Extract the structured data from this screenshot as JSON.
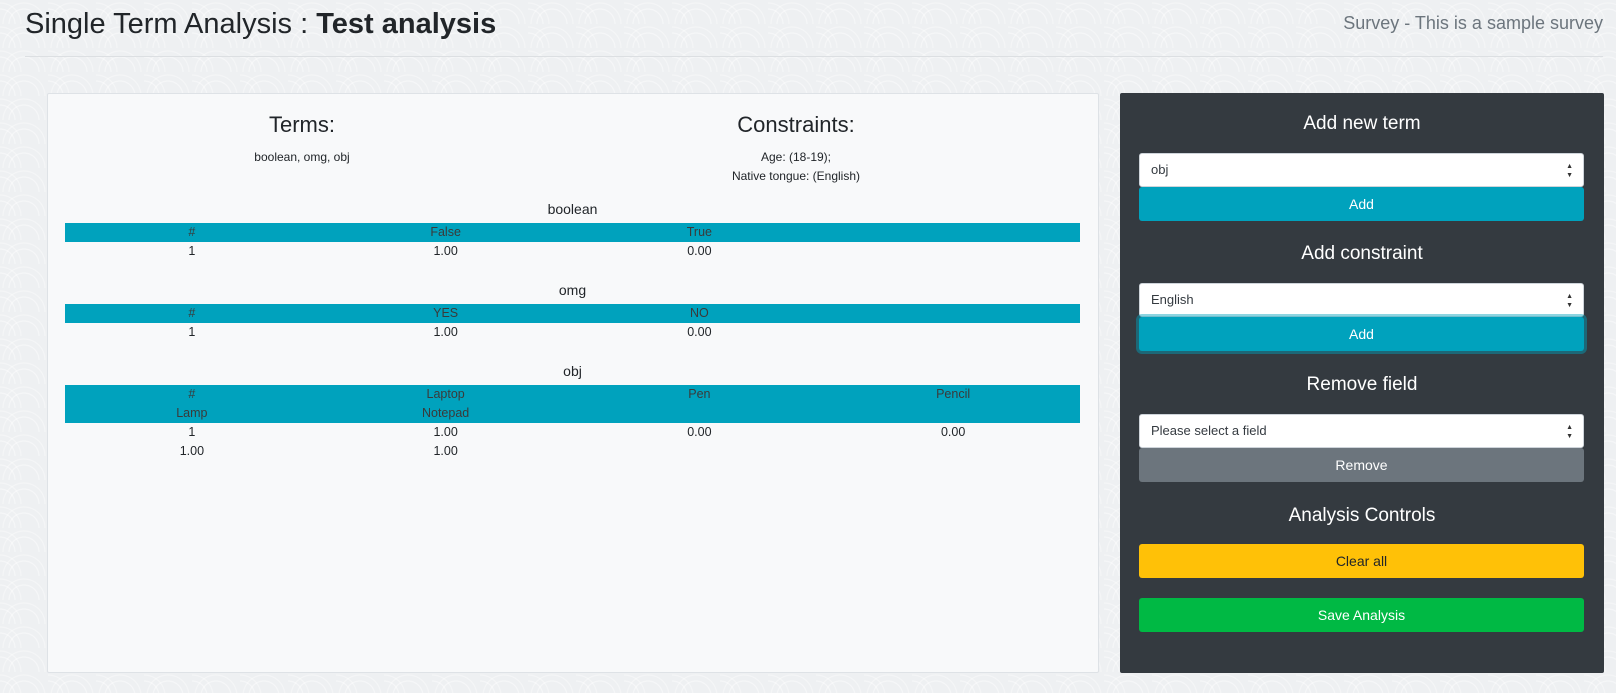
{
  "header": {
    "title_prefix": "Single Term Analysis : ",
    "title_name": "Test analysis",
    "survey": "Survey - This is a sample survey"
  },
  "summary": {
    "terms_heading": "Terms:",
    "terms_list": "boolean, omg, obj",
    "constraints_heading": "Constraints:",
    "constraint_lines": [
      "Age: (18-19);",
      "Native tongue: (English)"
    ]
  },
  "terms": [
    {
      "name": "boolean",
      "header_rows": [
        [
          "#",
          "False",
          "True",
          ""
        ]
      ],
      "data_rows": [
        [
          "1",
          "1.00",
          "0.00",
          ""
        ]
      ]
    },
    {
      "name": "omg",
      "header_rows": [
        [
          "#",
          "YES",
          "NO",
          ""
        ]
      ],
      "data_rows": [
        [
          "1",
          "1.00",
          "0.00",
          ""
        ]
      ]
    },
    {
      "name": "obj",
      "header_rows": [
        [
          "#",
          "Laptop",
          "Pen",
          "Pencil"
        ],
        [
          "Lamp",
          "Notepad",
          "",
          ""
        ]
      ],
      "data_rows": [
        [
          "1",
          "1.00",
          "0.00",
          "0.00"
        ],
        [
          "1.00",
          "1.00",
          "",
          ""
        ]
      ]
    }
  ],
  "sidebar": {
    "add_term_title": "Add new term",
    "term_select_value": "obj",
    "add_term_button": "Add",
    "add_constraint_title": "Add constraint",
    "constraint_select_value": "English",
    "add_constraint_button": "Add",
    "remove_field_title": "Remove field",
    "remove_select_placeholder": "Please select a field",
    "remove_button": "Remove",
    "controls_title": "Analysis Controls",
    "clear_button": "Clear all",
    "save_button": "Save Analysis"
  },
  "icons": {
    "select_caret": "updown-caret-icon"
  },
  "colors": {
    "accent": "#00a2bd",
    "warning": "#ffc107",
    "success": "#00b944",
    "secondary": "#6c757d",
    "sidebar_bg": "#343a40"
  }
}
